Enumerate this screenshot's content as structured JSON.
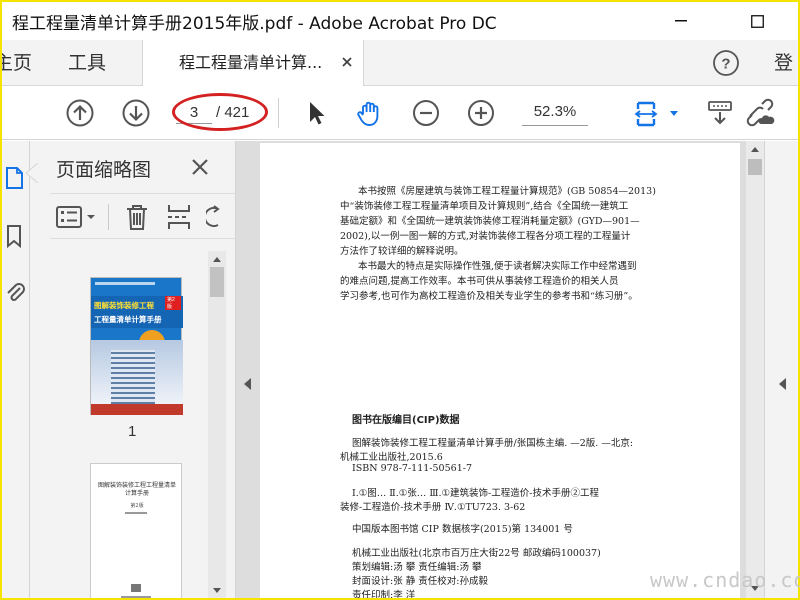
{
  "window": {
    "title": "程工程量清单计算手册2015年版.pdf - Adobe Acrobat Pro DC",
    "minimize": "—",
    "maximize": "☐"
  },
  "menubar": {
    "home": "主页",
    "tools": "工具",
    "doc_tab": "程工程量清单计算...",
    "login": "登"
  },
  "toolbar": {
    "current_page": "3",
    "total_pages": "/ 421",
    "zoom": "52.3%"
  },
  "thumbnails": {
    "title": "页面缩略图",
    "items": [
      {
        "page_label": "1",
        "cover_title_1": "图解装饰装修工程",
        "cover_title_2": "工程量清单计算手册",
        "badge": "第2版"
      },
      {
        "cover_title": "图解装饰装修工程工程量清单计算手册",
        "edition": "第2版"
      }
    ]
  },
  "document": {
    "lines": [
      "本书按照《房屋建筑与装饰工程工程量计算规范》(GB 50854—2013)",
      "中“装饰装修工程工程量清单项目及计算规则”,结合《全国统一建筑工",
      "基础定额》和《全国统一建筑装饰装修工程消耗量定额》(GYD—901—",
      "2002),以一例一图一解的方式,对装饰装修工程各分项工程的工程量计",
      "方法作了较详细的解释说明。",
      "本书最大的特点是实际操作性强,便于读者解决实际工作中经常遇到",
      "的难点问题,提高工作效率。本书可供从事装修工程造价的相关人员",
      "学习参考,也可作为高校工程造价及相关专业学生的参考书和“练习册”。"
    ],
    "cip_title": "图书在版编目(CIP)数据",
    "cip_lines": [
      "图解装饰装修工程工程量清单计算手册/张国栋主编. —2版. —北京:",
      "机械工业出版社,2015.6",
      "ISBN 978-7-111-50561-7",
      "Ⅰ.①图…  Ⅱ.①张…  Ⅲ.①建筑装饰-工程造价-技术手册②工程",
      "装修-工程造价-技术手册  Ⅳ.①TU723. 3-62",
      "中国版本图书馆 CIP 数据核字(2015)第 134001 号",
      "机械工业出版社(北京市百万庄大街22号  邮政编码100037)",
      "策划编辑:汤  攀  责任编辑:汤  攀",
      "封面设计:张  静  责任校对:孙成毅",
      "责任印制:李  洋"
    ]
  },
  "watermark": "www.cndao.com"
}
